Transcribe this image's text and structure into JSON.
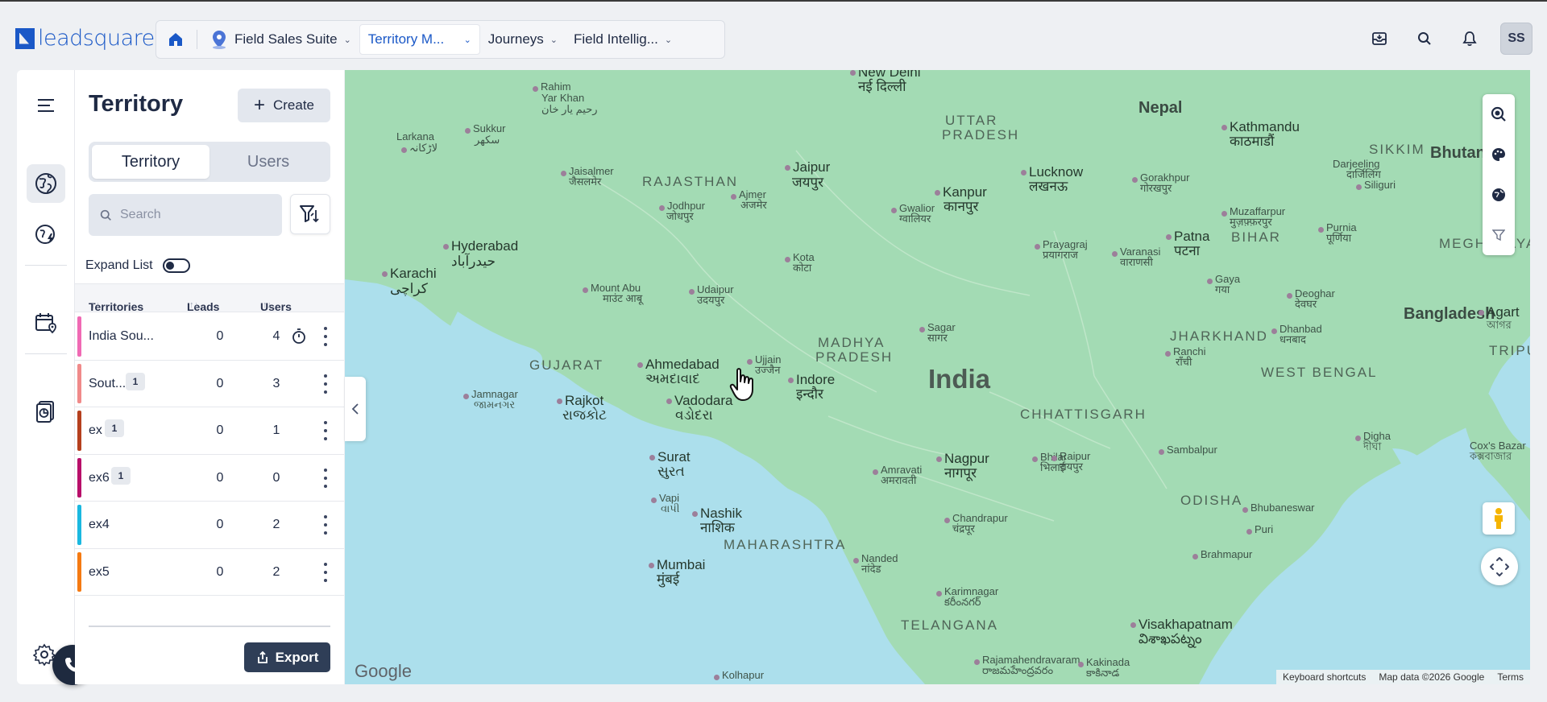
{
  "brand": {
    "name": "leadsquared"
  },
  "nav": {
    "home_icon": "home-icon",
    "items": [
      {
        "label": "Field Sales Suite",
        "icon": "map-pin-icon"
      },
      {
        "label": "Territory M...",
        "active": true
      },
      {
        "label": "Journeys"
      },
      {
        "label": "Field Intellig..."
      }
    ]
  },
  "topbar": {
    "avatar_initials": "SS",
    "icons": [
      "inbox-icon",
      "search-icon",
      "bell-icon"
    ]
  },
  "panel": {
    "title": "Territory",
    "create_label": "Create",
    "tabs": [
      {
        "label": "Territory",
        "active": true
      },
      {
        "label": "Users"
      }
    ],
    "search_placeholder": "Search",
    "expand_label": "Expand List",
    "columns": {
      "territories": "Territories",
      "leads": "Leads",
      "users": "Users"
    },
    "rows": [
      {
        "name": "India Sou...",
        "badge": "",
        "leads": "0",
        "users": "4",
        "timer": true,
        "color": "#f06ab4"
      },
      {
        "name": "Sout...",
        "badge": "1",
        "leads": "0",
        "users": "3",
        "timer": false,
        "color": "#f08a8a"
      },
      {
        "name": "ex",
        "badge": "1",
        "leads": "0",
        "users": "1",
        "timer": false,
        "color": "#b5401e"
      },
      {
        "name": "ex6",
        "badge": "1",
        "leads": "0",
        "users": "0",
        "timer": false,
        "color": "#b80f6a"
      },
      {
        "name": "ex4",
        "badge": "",
        "leads": "0",
        "users": "2",
        "timer": false,
        "color": "#1ab8e0"
      },
      {
        "name": "ex5",
        "badge": "",
        "leads": "0",
        "users": "2",
        "timer": false,
        "color": "#f57a12"
      }
    ],
    "export_label": "Export"
  },
  "map": {
    "attribution": {
      "shortcuts": "Keyboard shortcuts",
      "data": "Map data ©2026 Google",
      "terms": "Terms"
    },
    "google_label": "Google",
    "labels": {
      "new_delhi": "New Delhi",
      "new_delhi_hi": "नई दिल्ली",
      "rahim": "Rahim",
      "rahim2": "Yar Khan",
      "rahim_ur": "رحیم یار خان",
      "larkana": "Larkana",
      "larkana_ur": "لاڑکانہ",
      "sukkur": "Sukkur",
      "sukkur_ur": "سکھر",
      "uttar": "UTTAR",
      "pradesh": "PRADESH",
      "nepal": "Nepal",
      "kathmandu": "Kathmandu",
      "kathmandu_ne": "काठमाडौं",
      "sikkim": "SIKKIM",
      "bhutan": "Bhutan",
      "jaisalmer": "Jaisalmer",
      "jaisalmer_hi": "जैसलमेर",
      "rajasthan": "RAJASTHAN",
      "jaipur": "Jaipur",
      "jaipur_hi": "जयपुर",
      "ajmer": "Ajmer",
      "ajmer_hi": "अजमेर",
      "lucknow": "Lucknow",
      "lucknow_hi": "लखनऊ",
      "kanpur": "Kanpur",
      "kanpur_hi": "कानपुर",
      "gorakhpur": "Gorakhpur",
      "gorakhpur_hi": "गोरखपुर",
      "darjeeling": "Darjeeling",
      "darjeeling_hi": "दार्जिलिंग",
      "siliguri": "Siliguri",
      "jodhpur": "Jodhpur",
      "jodhpur_hi": "जोधपुर",
      "gwalior": "Gwalior",
      "gwalior_hi": "ग्वालियर",
      "muzaffarpur": "Muzaffarpur",
      "muzaffarpur_hi": "मुज़फ़्फ़रपुर",
      "hyderabad_pk": "Hyderabad",
      "hyderabad_pk_ur": "حیدرآباد",
      "patna": "Patna",
      "patna_hi": "पटना",
      "bihar": "BIHAR",
      "purnia": "Purnia",
      "purnia_hi": "पूर्णिया",
      "meghalaya": "MEGHALAYA",
      "kota": "Kota",
      "kota_hi": "कोटा",
      "prayagraj": "Prayagraj",
      "prayagraj_hi": "प्रयागराज",
      "varanasi": "Varanasi",
      "varanasi_hi": "वाराणसी",
      "karachi": "Karachi",
      "karachi_ur": "کراچی",
      "gaya": "Gaya",
      "gaya_hi": "गया",
      "mountabu": "Mount Abu",
      "mountabu_hi": "माउंट आबू",
      "udaipur": "Udaipur",
      "udaipur_hi": "उदयपुर",
      "deoghar": "Deoghar",
      "deoghar_hi": "देवघर",
      "bangladesh": "Bangladesh",
      "agart": "Agart",
      "agart_bn": "আগর",
      "sagar": "Sagar",
      "sagar_hi": "सागर",
      "madhya": "MADHYA",
      "madhya_pradesh": "PRADESH",
      "jharkhand": "JHARKHAND",
      "dhanbad": "Dhanbad",
      "dhanbad_hi": "धनबाद",
      "ranchi": "Ranchi",
      "ranchi_hi": "राँची",
      "tripura": "TRIPUR",
      "gujarat": "GUJARAT",
      "ahmedabad": "Ahmedabad",
      "ahmedabad_gu": "અમદાવાદ",
      "ujjain": "Ujjain",
      "ujjain_hi": "उज्जैन",
      "indore": "Indore",
      "indore_hi": "इन्दौर",
      "india": "India",
      "westbengal": "WEST BENGAL",
      "jamnagar": "Jamnagar",
      "jamnagar_gu": "જામનગર",
      "rajkot": "Rajkot",
      "rajkot_gu": "રાજકોટ",
      "vadodara": "Vadodara",
      "vadodara_gu": "વડોદરા",
      "chhattisgarh": "CHHATTISGARH",
      "digha": "Digha",
      "digha_bn": "দীঘা",
      "coxsbazar": "Cox's Bazar",
      "coxsbazar_bn": "কক্সবাজার",
      "surat": "Surat",
      "surat_gu": "સુરત",
      "amravati": "Amravati",
      "amravati_hi": "अमरावती",
      "nagpur": "Nagpur",
      "nagpur_hi": "नागपूर",
      "bhilai": "Bhilai",
      "bhilai_hi": "भिलाई",
      "raipur": "Raipur",
      "raipur_hi": "रायपुर",
      "sambalpur": "Sambalpur",
      "vapi": "Vapi",
      "vapi_gu": "વાપી",
      "odisha": "ODISHA",
      "bhubaneswar": "Bhubaneswar",
      "nashik": "Nashik",
      "nashik_mr": "नाशिक",
      "chandrapur": "Chandrapur",
      "chandrapur_mr": "चंद्रपूर",
      "puri": "Puri",
      "maharashtra": "MAHARASHTRA",
      "mumbai": "Mumbai",
      "mumbai_mr": "मुंबई",
      "nanded": "Nanded",
      "nanded_mr": "नांदेड",
      "brahmapur": "Brahmapur",
      "karimnagar": "Karimnagar",
      "karimnagar_te": "కరీంనగర్",
      "telangana": "TELANGANA",
      "visakhapatnam": "Visakhapatnam",
      "visakhapatnam_te": "విశాఖపట్నం",
      "rajamahendravaram": "Rajamahendravaram",
      "rajamahendravaram_te": "రాజమహేంద్రవరం",
      "kakinada": "Kakinada",
      "kakinada_te": "కాకినాడ",
      "kolhapur": "Kolhapur"
    }
  },
  "colors": {
    "brand": "#1a58c7",
    "land": "#a3dbb4",
    "water": "#acdfec",
    "dark_button": "#2f3e57"
  }
}
